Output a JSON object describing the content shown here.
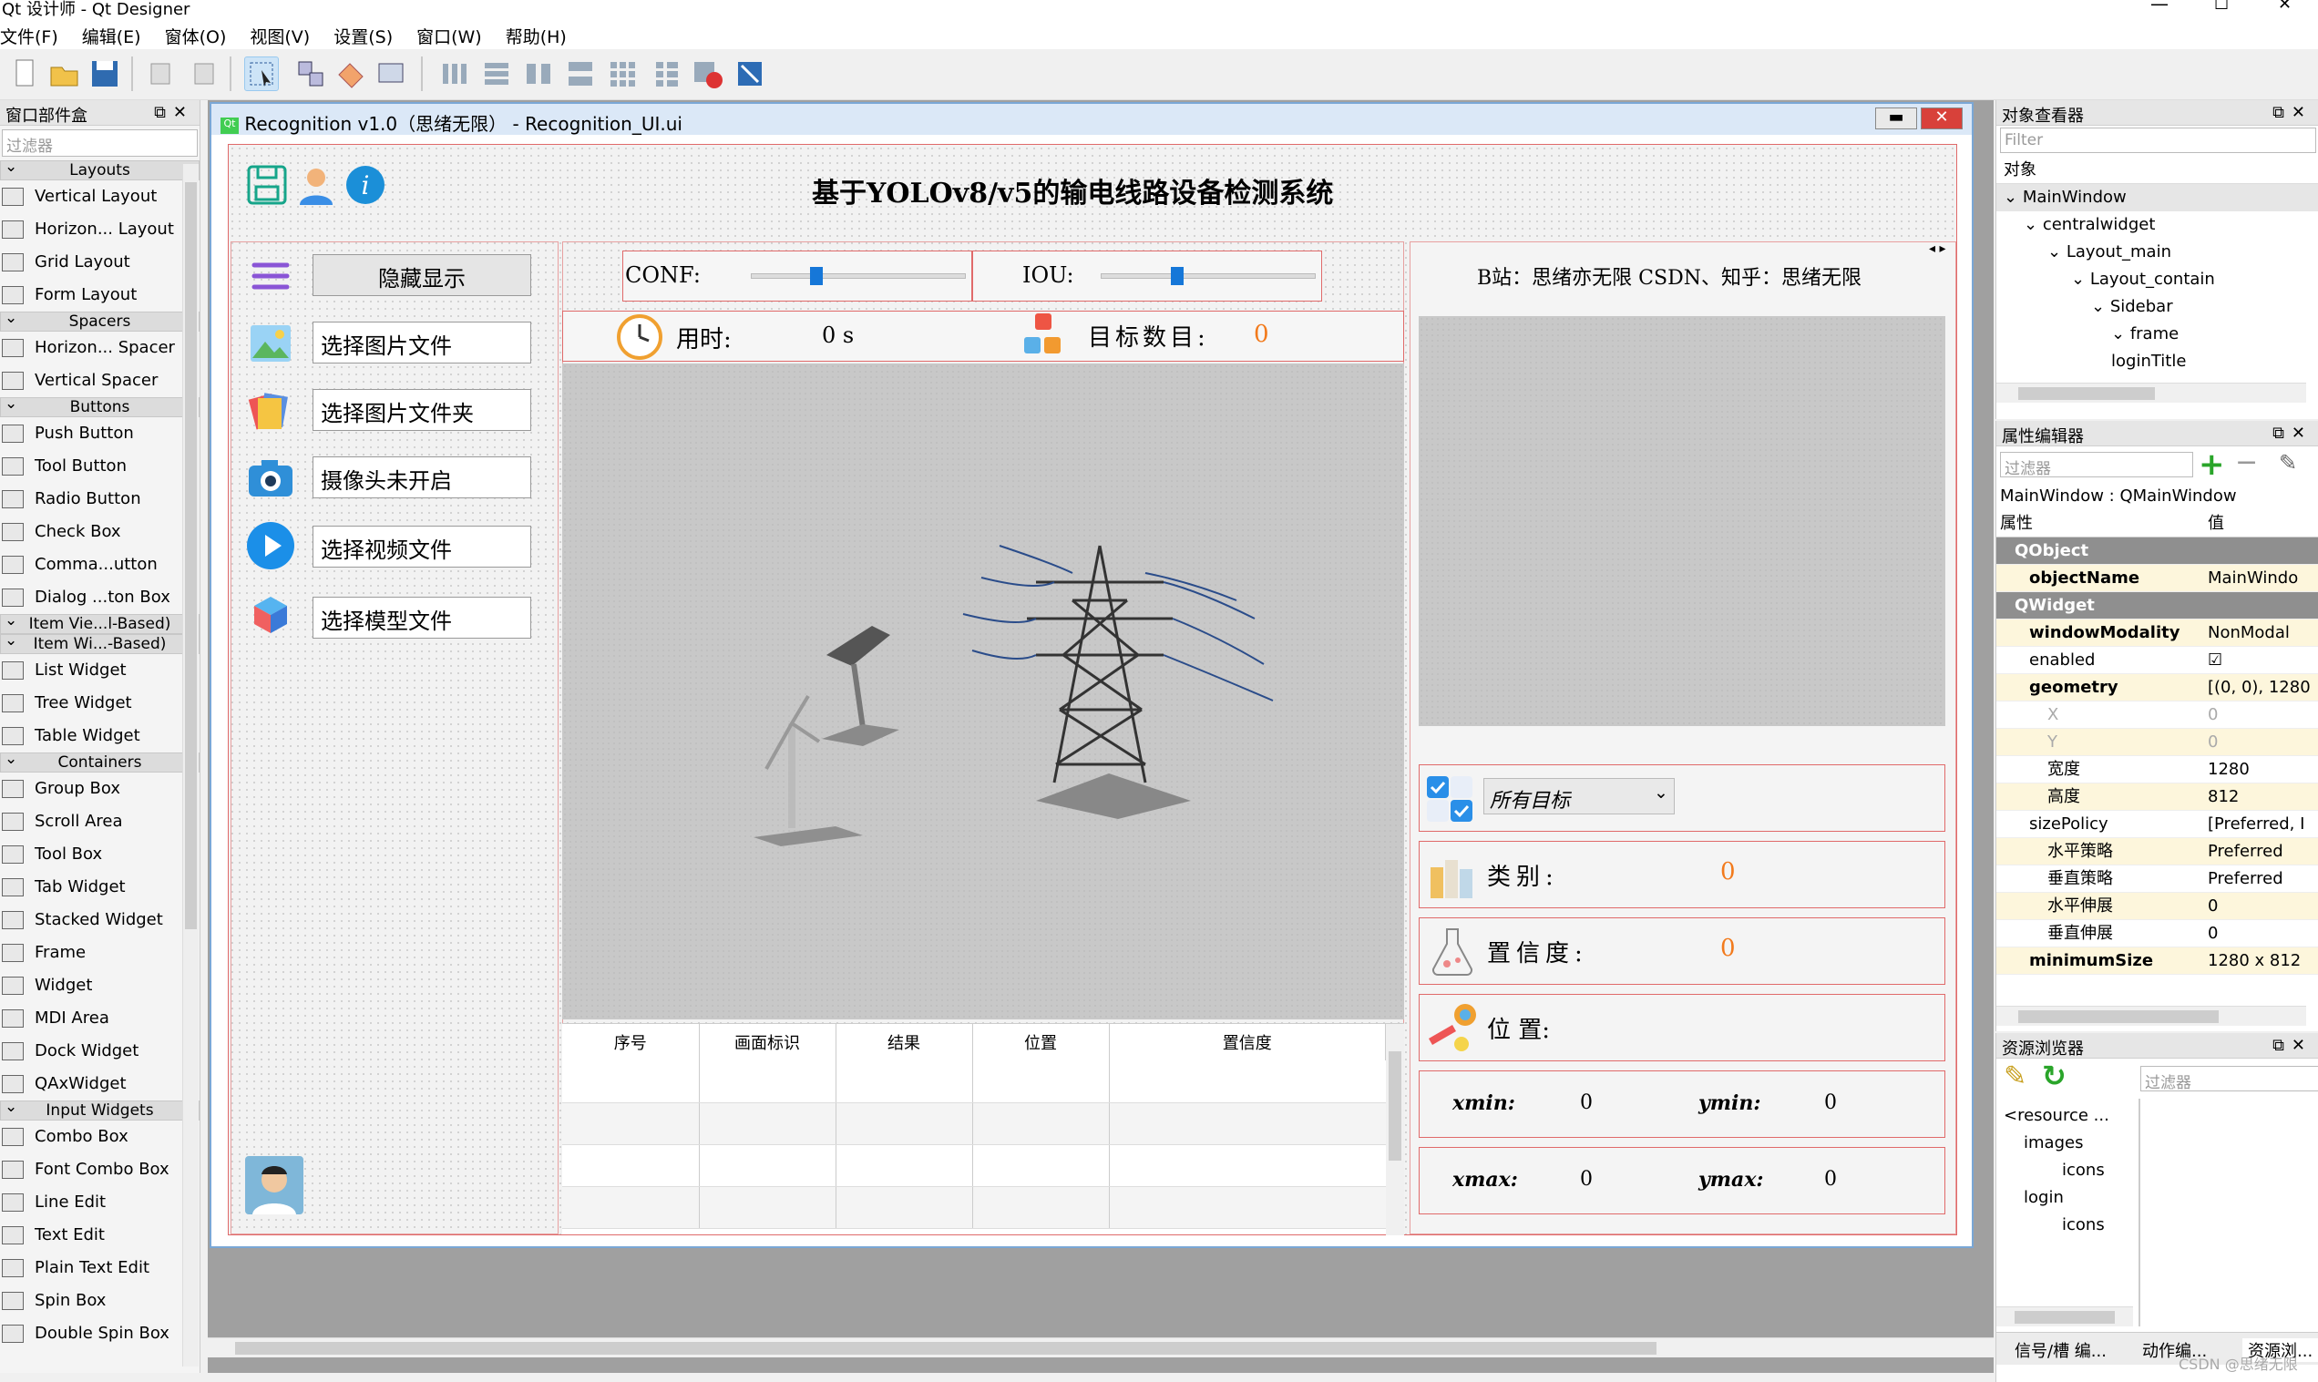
{
  "app": {
    "title": "Qt 设计师 - Qt Designer",
    "win_controls": [
      "—",
      "☐",
      "✕"
    ]
  },
  "menu": [
    "文件(F)",
    "编辑(E)",
    "窗体(O)",
    "视图(V)",
    "设置(S)",
    "窗口(W)",
    "帮助(H)"
  ],
  "widgetbox": {
    "title": "窗口部件盒",
    "filter_placeholder": "过滤器",
    "groups": [
      {
        "name": "Layouts",
        "items": [
          "Vertical Layout",
          "Horizon... Layout",
          "Grid Layout",
          "Form Layout"
        ]
      },
      {
        "name": "Spacers",
        "items": [
          "Horizon... Spacer",
          "Vertical Spacer"
        ]
      },
      {
        "name": "Buttons",
        "items": [
          "Push Button",
          "Tool Button",
          "Radio Button",
          "Check Box",
          "Comma...utton",
          "Dialog ...ton Box"
        ]
      },
      {
        "name": "Item Vie...l-Based)",
        "items": []
      },
      {
        "name": "Item Wi...-Based)",
        "items": [
          "List Widget",
          "Tree Widget",
          "Table Widget"
        ]
      },
      {
        "name": "Containers",
        "items": [
          "Group Box",
          "Scroll Area",
          "Tool Box",
          "Tab Widget",
          "Stacked Widget",
          "Frame",
          "Widget",
          "MDI Area",
          "Dock Widget",
          "QAxWidget"
        ]
      },
      {
        "name": "Input Widgets",
        "items": [
          "Combo Box",
          "Font Combo Box",
          "Line Edit",
          "Text Edit",
          "Plain Text Edit",
          "Spin Box",
          "Double Spin Box"
        ]
      }
    ]
  },
  "form": {
    "window_title": "Recognition v1.0（思绪无限） - Recognition_UI.ui",
    "heading": "基于YOLOv8/v5的输电线路设备检测系统",
    "side_buttons": [
      "隐藏显示",
      "选择图片文件",
      "选择图片文件夹",
      "摄像头未开启",
      "选择视频文件",
      "选择模型文件"
    ],
    "conf_label": "CONF:",
    "iou_label": "IOU:",
    "conf_value": 0.3,
    "iou_value": 0.35,
    "time_label": "用时:",
    "time_value": "0 s",
    "count_label": "目标数目:",
    "count_value": "0",
    "table_headers": [
      "序号",
      "画面标识",
      "结果",
      "位置",
      "置信度"
    ],
    "credit": "B站：思绪亦无限 CSDN、知乎：思绪无限",
    "target_select": "所有目标",
    "class_label": "类别:",
    "class_value": "0",
    "conf2_label": "置信度:",
    "conf2_value": "0",
    "pos_label": "位 置:",
    "xmin_label": "xmin:",
    "xmin_value": "0",
    "ymin_label": "ymin:",
    "ymin_value": "0",
    "xmax_label": "xmax:",
    "xmax_value": "0",
    "ymax_label": "ymax:",
    "ymax_value": "0"
  },
  "object_inspector": {
    "title": "对象查看器",
    "filter_placeholder": "Filter",
    "column": "对象",
    "tree": [
      "MainWindow",
      "centralwidget",
      "Layout_main",
      "Layout_contain",
      "Sidebar",
      "frame",
      "loginTitle"
    ]
  },
  "property_editor": {
    "title": "属性编辑器",
    "filter_placeholder": "过滤器",
    "context": "MainWindow : QMainWindow",
    "col_prop": "属性",
    "col_val": "值",
    "rows": [
      {
        "k": "QObject",
        "v": "",
        "type": "grp"
      },
      {
        "k": "objectName",
        "v": "MainWindo",
        "type": "bold"
      },
      {
        "k": "QWidget",
        "v": "",
        "type": "grp"
      },
      {
        "k": "windowModality",
        "v": "NonModal",
        "type": "bold"
      },
      {
        "k": "enabled",
        "v": "☑",
        "type": "norm"
      },
      {
        "k": "geometry",
        "v": "[(0, 0), 1280",
        "type": "bold"
      },
      {
        "k": "X",
        "v": "0",
        "type": "dim"
      },
      {
        "k": "Y",
        "v": "0",
        "type": "dim"
      },
      {
        "k": "宽度",
        "v": "1280",
        "type": "norm"
      },
      {
        "k": "高度",
        "v": "812",
        "type": "norm"
      },
      {
        "k": "sizePolicy",
        "v": "[Preferred, I",
        "type": "norm"
      },
      {
        "k": "水平策略",
        "v": "Preferred",
        "type": "norm"
      },
      {
        "k": "垂直策略",
        "v": "Preferred",
        "type": "norm"
      },
      {
        "k": "水平伸展",
        "v": "0",
        "type": "norm"
      },
      {
        "k": "垂直伸展",
        "v": "0",
        "type": "norm"
      },
      {
        "k": "minimumSize",
        "v": "1280 x 812",
        "type": "bold"
      }
    ]
  },
  "resource_browser": {
    "title": "资源浏览器",
    "filter_placeholder": "过滤器",
    "tree": [
      "<resource ...",
      "images",
      "icons",
      "login",
      "icons"
    ],
    "tabs": [
      "信号/槽 编...",
      "动作编...",
      "资源浏..."
    ]
  },
  "watermark": "CSDN @思绪无限"
}
